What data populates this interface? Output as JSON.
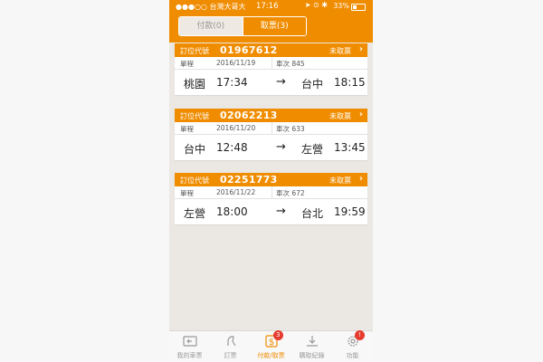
{
  "status_bar": {
    "carrier": "●●●○○ 台灣大哥大",
    "time": "17:16",
    "battery": "33%"
  },
  "header": {
    "tabs": [
      {
        "label": "付款(0)"
      },
      {
        "label": "取票(3)"
      }
    ],
    "active_tab": 1
  },
  "tickets": [
    {
      "booking_label": "訂位代號",
      "booking_code": "01967612",
      "status": "未取票",
      "type": "單程",
      "date": "2016/11/19",
      "train": "車次 845",
      "from": "桃園",
      "depart": "17:34",
      "to": "台中",
      "arrive": "18:15"
    },
    {
      "booking_label": "訂位代號",
      "booking_code": "02062213",
      "status": "未取票",
      "type": "單程",
      "date": "2016/11/20",
      "train": "車次 633",
      "from": "台中",
      "depart": "12:48",
      "to": "左營",
      "arrive": "13:45"
    },
    {
      "booking_label": "訂位代號",
      "booking_code": "02251773",
      "status": "未取票",
      "type": "單程",
      "date": "2016/11/22",
      "train": "車次 672",
      "from": "左營",
      "depart": "18:00",
      "to": "台北",
      "arrive": "19:59"
    }
  ],
  "tabbar": [
    {
      "label": "我的車票",
      "icon": "ticket-icon"
    },
    {
      "label": "訂票",
      "icon": "seat-icon"
    },
    {
      "label": "付款/取票",
      "icon": "dollar-icon",
      "badge": "3",
      "active": true
    },
    {
      "label": "購取紀錄",
      "icon": "download-icon"
    },
    {
      "label": "功能",
      "icon": "gear-icon",
      "badge": "!"
    }
  ],
  "colors": {
    "accent": "#f08c00",
    "badge": "#e63b2e",
    "background": "#ebe8e3"
  }
}
